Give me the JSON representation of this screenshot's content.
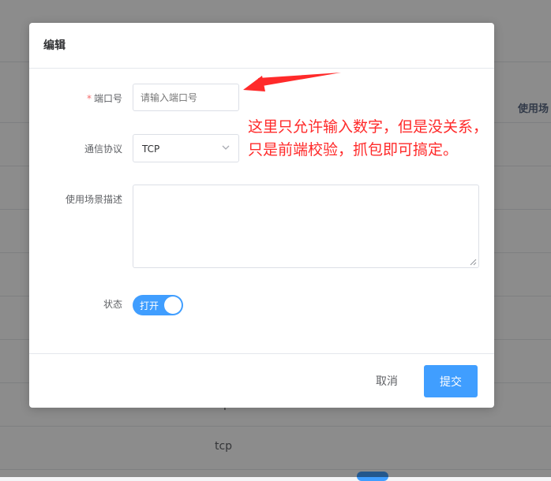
{
  "background": {
    "column_header": "使用场",
    "row_cut_text": "p",
    "row_protocol": "tcp"
  },
  "dialog": {
    "title": "编辑",
    "fields": {
      "port": {
        "required_mark": "*",
        "label": "端口号",
        "placeholder": "请输入端口号",
        "value": ""
      },
      "protocol": {
        "label": "通信协议",
        "selected": "TCP"
      },
      "description": {
        "label": "使用场景描述",
        "value": ""
      },
      "status": {
        "label": "状态",
        "switch_text": "打开",
        "on": true
      }
    },
    "footer": {
      "cancel_label": "取消",
      "submit_label": "提交"
    }
  },
  "annotation": {
    "line1": "这里只允许输入数字，但是没关系，",
    "line2": "只是前端校验，抓包即可搞定。"
  },
  "colors": {
    "primary": "#409eff",
    "required": "#f56c6c",
    "annotation": "#ff2a2a",
    "overlay": "rgba(0,0,0,0.45)"
  }
}
